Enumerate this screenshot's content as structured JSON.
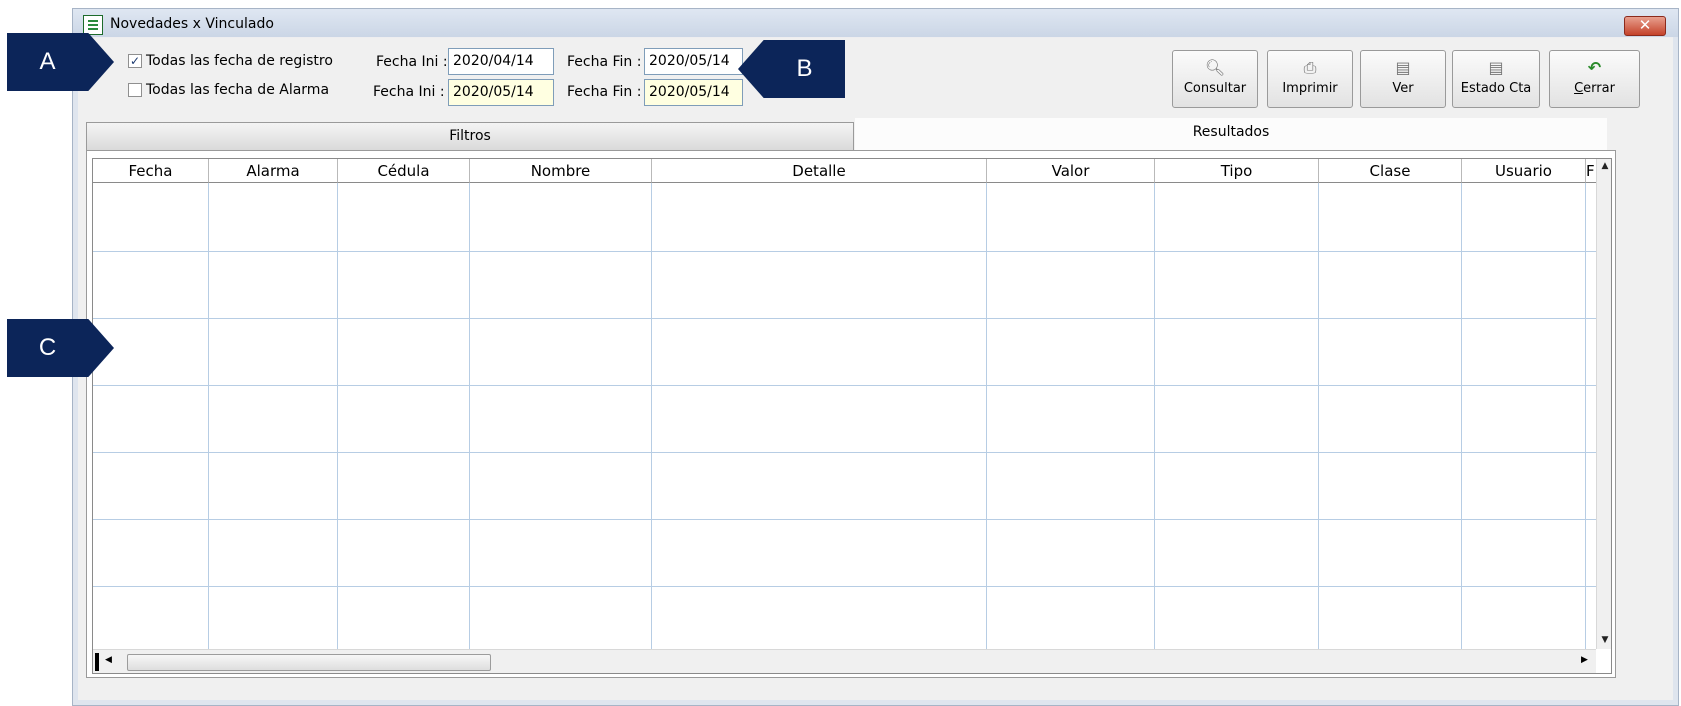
{
  "window": {
    "title": "Novedades x Vinculado",
    "close_glyph": "✕",
    "icon": "spreadsheet-doc-icon"
  },
  "filters": {
    "registro": {
      "label": "Todas las fecha de registro",
      "checked": true
    },
    "alarma": {
      "label": "Todas las fecha de Alarma",
      "checked": false
    },
    "row1": {
      "ini_label": "Fecha Ini :",
      "ini_value": "2020/04/14",
      "fin_label": "Fecha Fin :",
      "fin_value": "2020/05/14"
    },
    "row2": {
      "ini_label": "Fecha Ini :",
      "ini_value": "2020/05/14",
      "fin_label": "Fecha Fin :",
      "fin_value": "2020/05/14"
    }
  },
  "toolbar": {
    "consultar": {
      "label": "Consultar",
      "icon": "magnifier-doc-icon"
    },
    "imprimir": {
      "label": "Imprimir",
      "icon": "printer-icon"
    },
    "ver": {
      "label": "Ver",
      "icon": "view-doc-icon"
    },
    "estado_cta": {
      "label": "Estado Cta",
      "icon": "account-doc-icon"
    },
    "cerrar": {
      "label_prefix": "C",
      "label_rest": "errar",
      "icon": "undo-arrow-icon"
    }
  },
  "tabs": {
    "filtros": "Filtros",
    "resultados": "Resultados"
  },
  "grid": {
    "columns": [
      "Fecha",
      "Alarma",
      "Cédula",
      "Nombre",
      "Detalle",
      "Valor",
      "Tipo",
      "Clase",
      "Usuario",
      "F"
    ]
  },
  "callouts": {
    "a": "A",
    "b": "B",
    "c": "C",
    "color": "#0c2559"
  }
}
